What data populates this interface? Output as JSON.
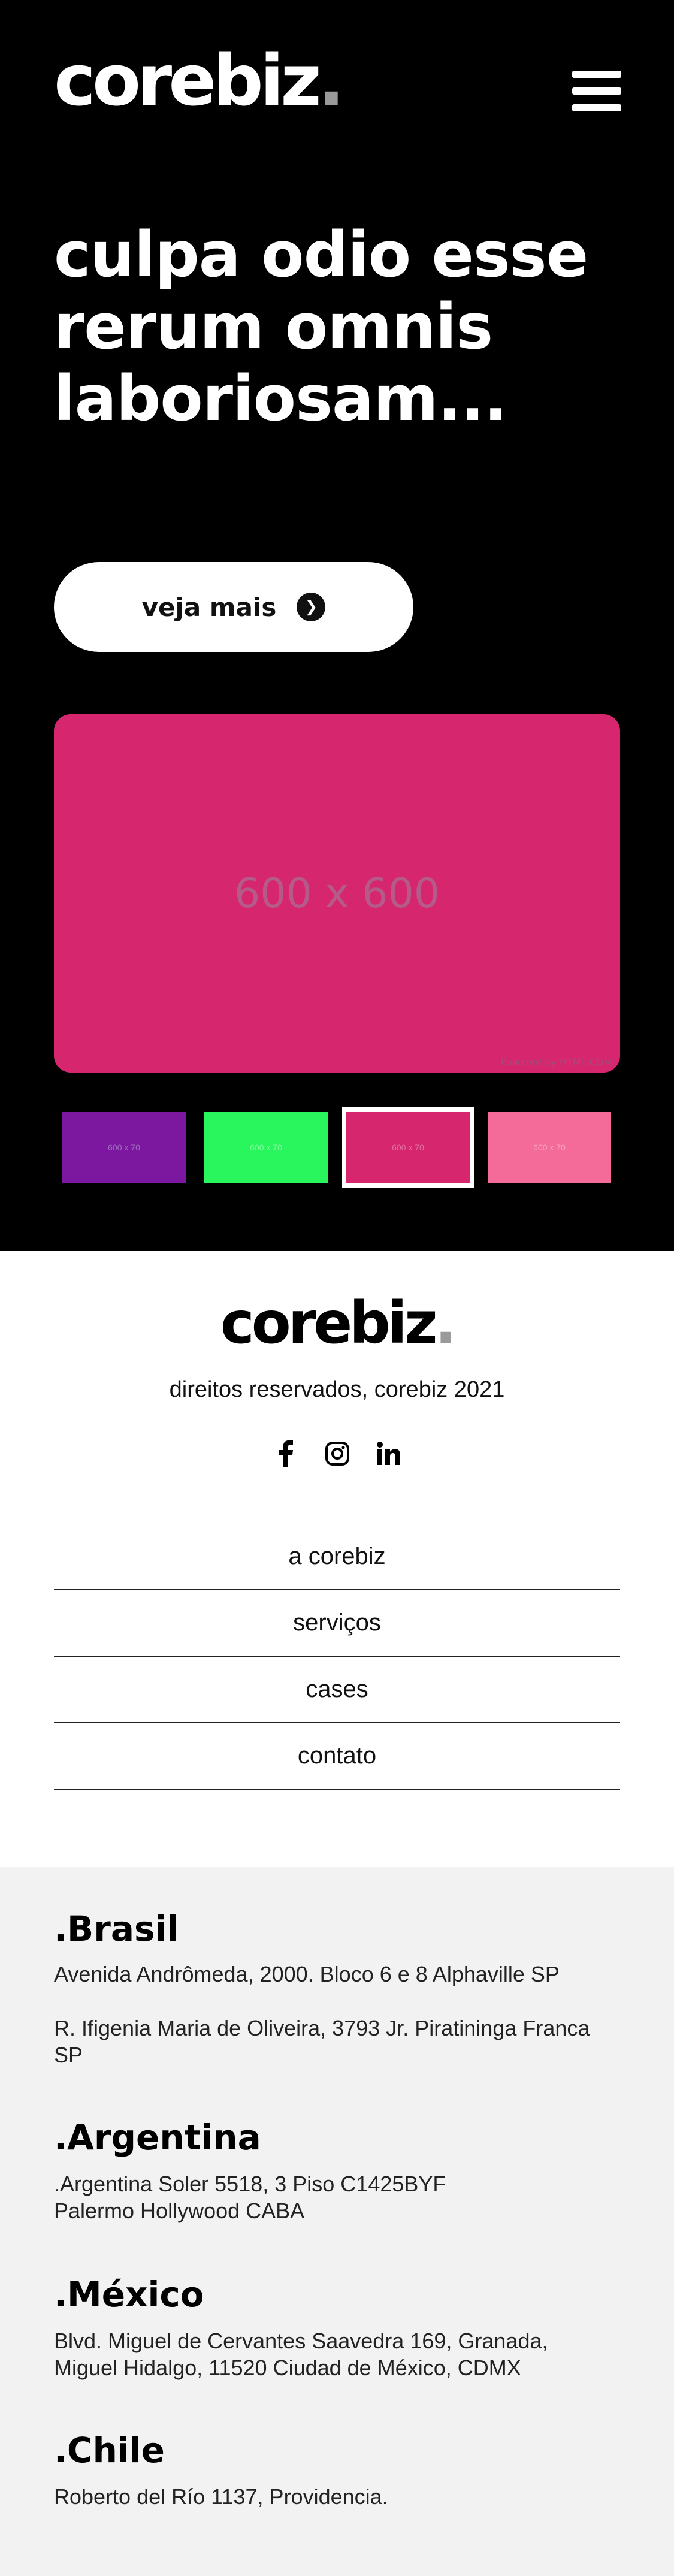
{
  "header": {
    "logo": "corebiz",
    "logo_dot": "."
  },
  "hero": {
    "headline": "culpa odio esse rerum omnis laboriosam...",
    "cta_label": "veja mais",
    "main_image": {
      "label": "600 x 600",
      "credit": "Powered by HTML.COM",
      "color": "#d6266e"
    },
    "thumbnails": [
      {
        "label": "600 x 70",
        "color": "#7b189f",
        "text_color": "#a36cc0"
      },
      {
        "label": "600 x 70",
        "color": "#29f65c",
        "text_color": "#7ffa9d"
      },
      {
        "label": "600 x 70",
        "color": "#d6266e",
        "text_color": "#e0709c"
      },
      {
        "label": "600 x 70",
        "color": "#f46a99",
        "text_color": "#f7a2bf"
      }
    ]
  },
  "footer": {
    "logo": "corebiz",
    "logo_dot": ".",
    "copyright": "direitos reservados, corebiz 2021",
    "social": [
      "facebook-icon",
      "instagram-icon",
      "linkedin-icon"
    ],
    "nav": [
      "a corebiz",
      "serviços",
      "cases",
      "contato"
    ]
  },
  "offices": [
    {
      "country": ".Brasil",
      "addresses": [
        "Avenida Andrômeda, 2000. Bloco 6 e 8 Alphaville SP",
        "R. Ifigenia Maria de Oliveira, 3793 Jr. Piratininga Franca SP"
      ]
    },
    {
      "country": ".Argentina",
      "addresses": [
        ".Argentina Soler 5518, 3 Piso C1425BYF Palermo Hollywood CABA"
      ]
    },
    {
      "country": ".México",
      "addresses": [
        "Blvd. Miguel de Cervantes Saavedra 169, Granada, Miguel Hidalgo, 11520 Ciudad de México, CDMX"
      ]
    },
    {
      "country": ".Chile",
      "addresses": [
        "Roberto del Río 1137, Providencia."
      ]
    }
  ]
}
